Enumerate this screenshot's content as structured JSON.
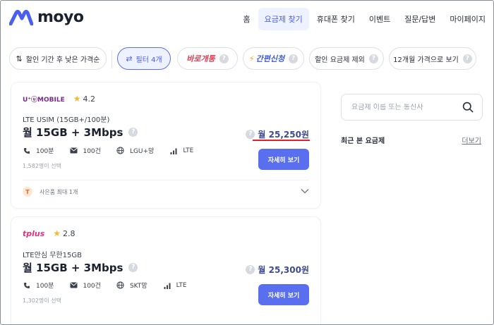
{
  "header": {
    "brand": "moyo",
    "nav": [
      {
        "label": "홈",
        "active": false
      },
      {
        "label": "요금제 찾기",
        "active": true
      },
      {
        "label": "휴대폰 찾기",
        "active": false
      },
      {
        "label": "이벤트",
        "active": false
      },
      {
        "label": "질문/답변",
        "active": false
      },
      {
        "label": "마이페이지",
        "active": false
      }
    ]
  },
  "filters": {
    "sort_label": "할인 기간 후 낮은 가격순",
    "filter_label": "필터 4개",
    "promo_baro": "바로개통",
    "promo_easy": "간편신청",
    "exclude_discount": "할인 요금제 제외",
    "twelve_month": "12개월 가격으로 보기"
  },
  "plans": [
    {
      "carrier_logo": "U⁺ⓤMOBILE",
      "rating": "4.2",
      "name": "LTE USIM (15GB+/100분)",
      "title": "월 15GB + 3Mbps",
      "price": "월 25,250원",
      "specs": {
        "call": "100분",
        "sms": "100건",
        "network": "LGU+망",
        "type": "LTE"
      },
      "selected_count": "1,582명이 선택",
      "detail_label": "자세히 보기",
      "gift_text": "사은품 최대 1개",
      "gift_badge": "T"
    },
    {
      "carrier_logo": "tplus",
      "rating": "2.8",
      "name": "LTE안심 무한15GB",
      "title": "월 15GB + 3Mbps",
      "price": "월 25,300원",
      "specs": {
        "call": "100분",
        "sms": "100건",
        "network": "SKT망",
        "type": "LTE"
      },
      "selected_count": "1,302명이 선택",
      "detail_label": "자세히 보기"
    }
  ],
  "sidebar": {
    "search_placeholder": "요금제 이름 또는 통신사",
    "recent_title": "최근 본 요금제",
    "more_label": "더보기"
  },
  "colors": {
    "accent": "#5a6ff0",
    "accent_bg": "#eef1ff",
    "price_underline": "#e0202a",
    "star": "#f5b82e"
  },
  "icons": [
    "moyo-logo-icon",
    "sort-arrows-icon",
    "filter-sliders-icon",
    "help-icon",
    "bolt-icon",
    "star-icon",
    "phone-icon",
    "mail-icon",
    "globe-icon",
    "signal-icon",
    "gift-icon",
    "chevron-down-icon",
    "search-icon"
  ]
}
